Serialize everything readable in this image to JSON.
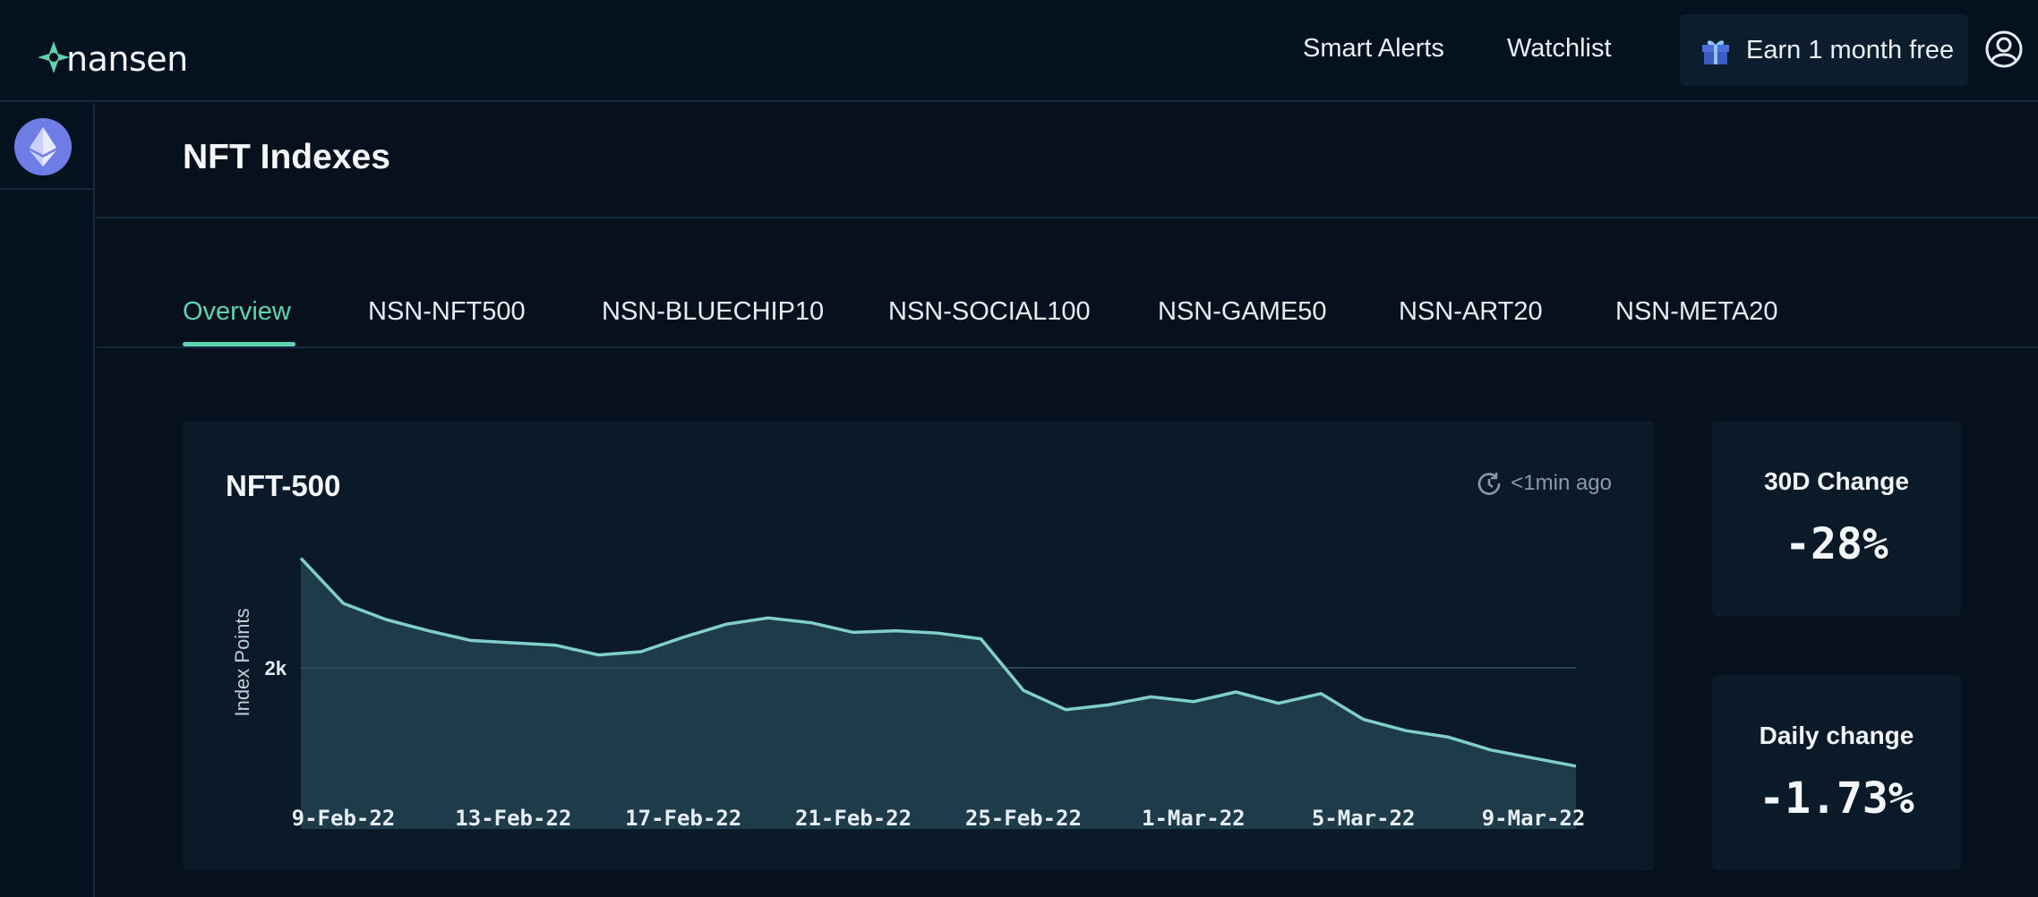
{
  "brand": {
    "name": "nansen",
    "accent": "#5fd3ae"
  },
  "topnav": {
    "smart_alerts": "Smart Alerts",
    "watchlist": "Watchlist",
    "earn": "Earn 1 month free"
  },
  "rail": {
    "chain": "Ethereum",
    "chain_icon": "ethereum-icon"
  },
  "page": {
    "title": "NFT Indexes"
  },
  "tabs": [
    {
      "label": "Overview",
      "active": true
    },
    {
      "label": "NSN-NFT500"
    },
    {
      "label": "NSN-BLUECHIP10"
    },
    {
      "label": "NSN-SOCIAL100"
    },
    {
      "label": "NSN-GAME50"
    },
    {
      "label": "NSN-ART20"
    },
    {
      "label": "NSN-META20"
    }
  ],
  "chart_card": {
    "title": "NFT-500",
    "updated": "<1min ago"
  },
  "chart_data": {
    "type": "area",
    "title": "NFT-500",
    "xlabel": "",
    "ylabel": "Index Points",
    "y_tick_labels": [
      {
        "value": 2000,
        "label": "2k"
      }
    ],
    "ylim": [
      1000,
      2700
    ],
    "grid": "horizontal line at 2k",
    "x_tick_labels": [
      "9-Feb-22",
      "13-Feb-22",
      "17-Feb-22",
      "21-Feb-22",
      "25-Feb-22",
      "1-Mar-22",
      "5-Mar-22",
      "9-Mar-22"
    ],
    "x": [
      "8-Feb-22",
      "9-Feb-22",
      "10-Feb-22",
      "11-Feb-22",
      "12-Feb-22",
      "13-Feb-22",
      "14-Feb-22",
      "15-Feb-22",
      "16-Feb-22",
      "17-Feb-22",
      "18-Feb-22",
      "19-Feb-22",
      "20-Feb-22",
      "21-Feb-22",
      "22-Feb-22",
      "23-Feb-22",
      "24-Feb-22",
      "25-Feb-22",
      "26-Feb-22",
      "27-Feb-22",
      "28-Feb-22",
      "1-Mar-22",
      "2-Mar-22",
      "3-Mar-22",
      "4-Mar-22",
      "5-Mar-22",
      "6-Mar-22",
      "7-Mar-22",
      "8-Mar-22",
      "9-Mar-22",
      "10-Mar-22"
    ],
    "series": [
      {
        "values": [
          2680,
          2400,
          2300,
          2230,
          2170,
          2155,
          2140,
          2080,
          2100,
          2190,
          2270,
          2310,
          2280,
          2220,
          2230,
          2215,
          2180,
          1860,
          1740,
          1770,
          1820,
          1790,
          1850,
          1780,
          1840,
          1680,
          1610,
          1570,
          1490,
          1440,
          1390
        ]
      }
    ],
    "line_color": "#7fcfcc",
    "fill_color": "#1e3b49"
  },
  "stats": {
    "thirty_day": {
      "label": "30D Change",
      "value": "-28%"
    },
    "daily": {
      "label": "Daily change",
      "value": "-1.73%"
    }
  }
}
